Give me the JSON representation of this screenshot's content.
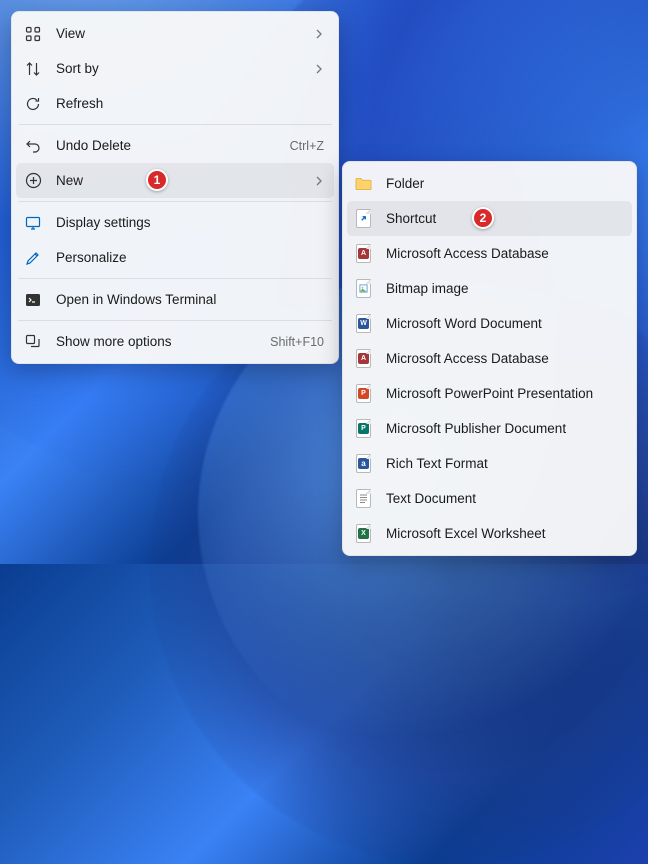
{
  "mainMenu": {
    "items": [
      {
        "label": "View",
        "hasSubmenu": true
      },
      {
        "label": "Sort by",
        "hasSubmenu": true
      },
      {
        "label": "Refresh"
      },
      {
        "label": "Undo Delete",
        "shortcut": "Ctrl+Z"
      },
      {
        "label": "New",
        "hasSubmenu": true,
        "highlighted": true
      },
      {
        "label": "Display settings"
      },
      {
        "label": "Personalize"
      },
      {
        "label": "Open in Windows Terminal"
      },
      {
        "label": "Show more options",
        "shortcut": "Shift+F10"
      }
    ]
  },
  "subMenu": {
    "items": [
      {
        "label": "Folder"
      },
      {
        "label": "Shortcut",
        "highlighted": true
      },
      {
        "label": "Microsoft Access Database"
      },
      {
        "label": "Bitmap image"
      },
      {
        "label": "Microsoft Word Document"
      },
      {
        "label": "Microsoft Access Database"
      },
      {
        "label": "Microsoft PowerPoint Presentation"
      },
      {
        "label": "Microsoft Publisher Document"
      },
      {
        "label": "Rich Text Format"
      },
      {
        "label": "Text Document"
      },
      {
        "label": "Microsoft Excel Worksheet"
      }
    ]
  },
  "annotations": {
    "badge1": "1",
    "badge2": "2"
  },
  "colors": {
    "word": "#2b579a",
    "access": "#a4373a",
    "powerpoint": "#d24726",
    "publisher": "#077568",
    "excel": "#217346",
    "folder": "#ffd36b",
    "shortcut": "#0067c0"
  }
}
